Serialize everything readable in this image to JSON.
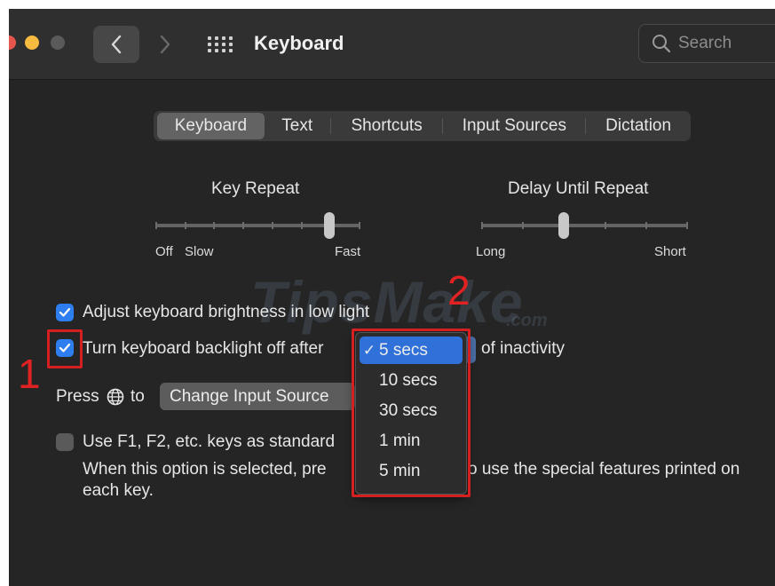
{
  "window": {
    "title": "Keyboard",
    "search_placeholder": "Search"
  },
  "tabs": [
    "Keyboard",
    "Text",
    "Shortcuts",
    "Input Sources",
    "Dictation"
  ],
  "active_tab": "Keyboard",
  "key_repeat": {
    "title": "Key Repeat",
    "label_left1": "Off",
    "label_left2": "Slow",
    "label_right": "Fast",
    "level": 0.85
  },
  "delay_until_repeat": {
    "title": "Delay Until Repeat",
    "label_left": "Long",
    "label_right": "Short",
    "level": 0.4
  },
  "options": {
    "adjust_brightness": {
      "label": "Adjust keyboard brightness in low light",
      "checked": true
    },
    "backlight_off": {
      "label_before": "Turn keyboard backlight off after",
      "label_after": "of inactivity",
      "checked": true
    },
    "press_globe": {
      "label_before": "Press",
      "label_after": "to",
      "popup_value": "Change Input Source"
    },
    "fn_keys": {
      "label": "Use F1, F2, etc. keys as standard",
      "desc_part1": "When this option is selected, pre",
      "desc_part2": "o use the special features printed on",
      "desc_line2": "each key.",
      "checked": false
    }
  },
  "dropdown": {
    "items": [
      "5 secs",
      "10 secs",
      "30 secs",
      "1 min",
      "5 min"
    ],
    "selected": "5 secs",
    "check_glyph": "✓"
  },
  "annotations": {
    "marker1": "1",
    "marker2": "2",
    "color": "#d42020"
  },
  "watermark": {
    "main": "TipsMake",
    "suffix": ".com"
  }
}
